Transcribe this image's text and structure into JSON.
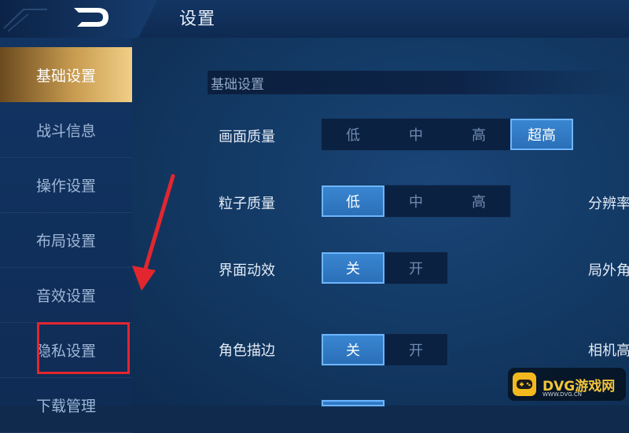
{
  "header": {
    "title": "设置",
    "back_icon": "back-arrow-icon"
  },
  "sidebar": {
    "items": [
      {
        "label": "基础设置",
        "active": true
      },
      {
        "label": "战斗信息"
      },
      {
        "label": "操作设置"
      },
      {
        "label": "布局设置"
      },
      {
        "label": "音效设置"
      },
      {
        "label": "隐私设置",
        "highlighted": true
      },
      {
        "label": "下载管理"
      }
    ]
  },
  "section": {
    "title": "基础设置"
  },
  "settings": [
    {
      "label": "画面质量",
      "options": [
        "低",
        "中",
        "高",
        "超高"
      ],
      "selected": "超高"
    },
    {
      "label": "粒子质量",
      "options": [
        "低",
        "中",
        "高"
      ],
      "selected": "低"
    },
    {
      "label": "界面动效",
      "options": [
        "关",
        "开"
      ],
      "selected": "关"
    },
    {
      "label": "角色描边",
      "options": [
        "关",
        "开"
      ],
      "selected": "关"
    }
  ],
  "right_labels": [
    "分辨率",
    "局外角",
    "相机高"
  ],
  "watermark": {
    "brand": "DVG游戏网",
    "url": "WWW.DVG.CN"
  },
  "colors": {
    "accent_gold": "#c79a4f",
    "toggle_on": "#2a6fb8",
    "annotation_red": "#e3262e"
  }
}
